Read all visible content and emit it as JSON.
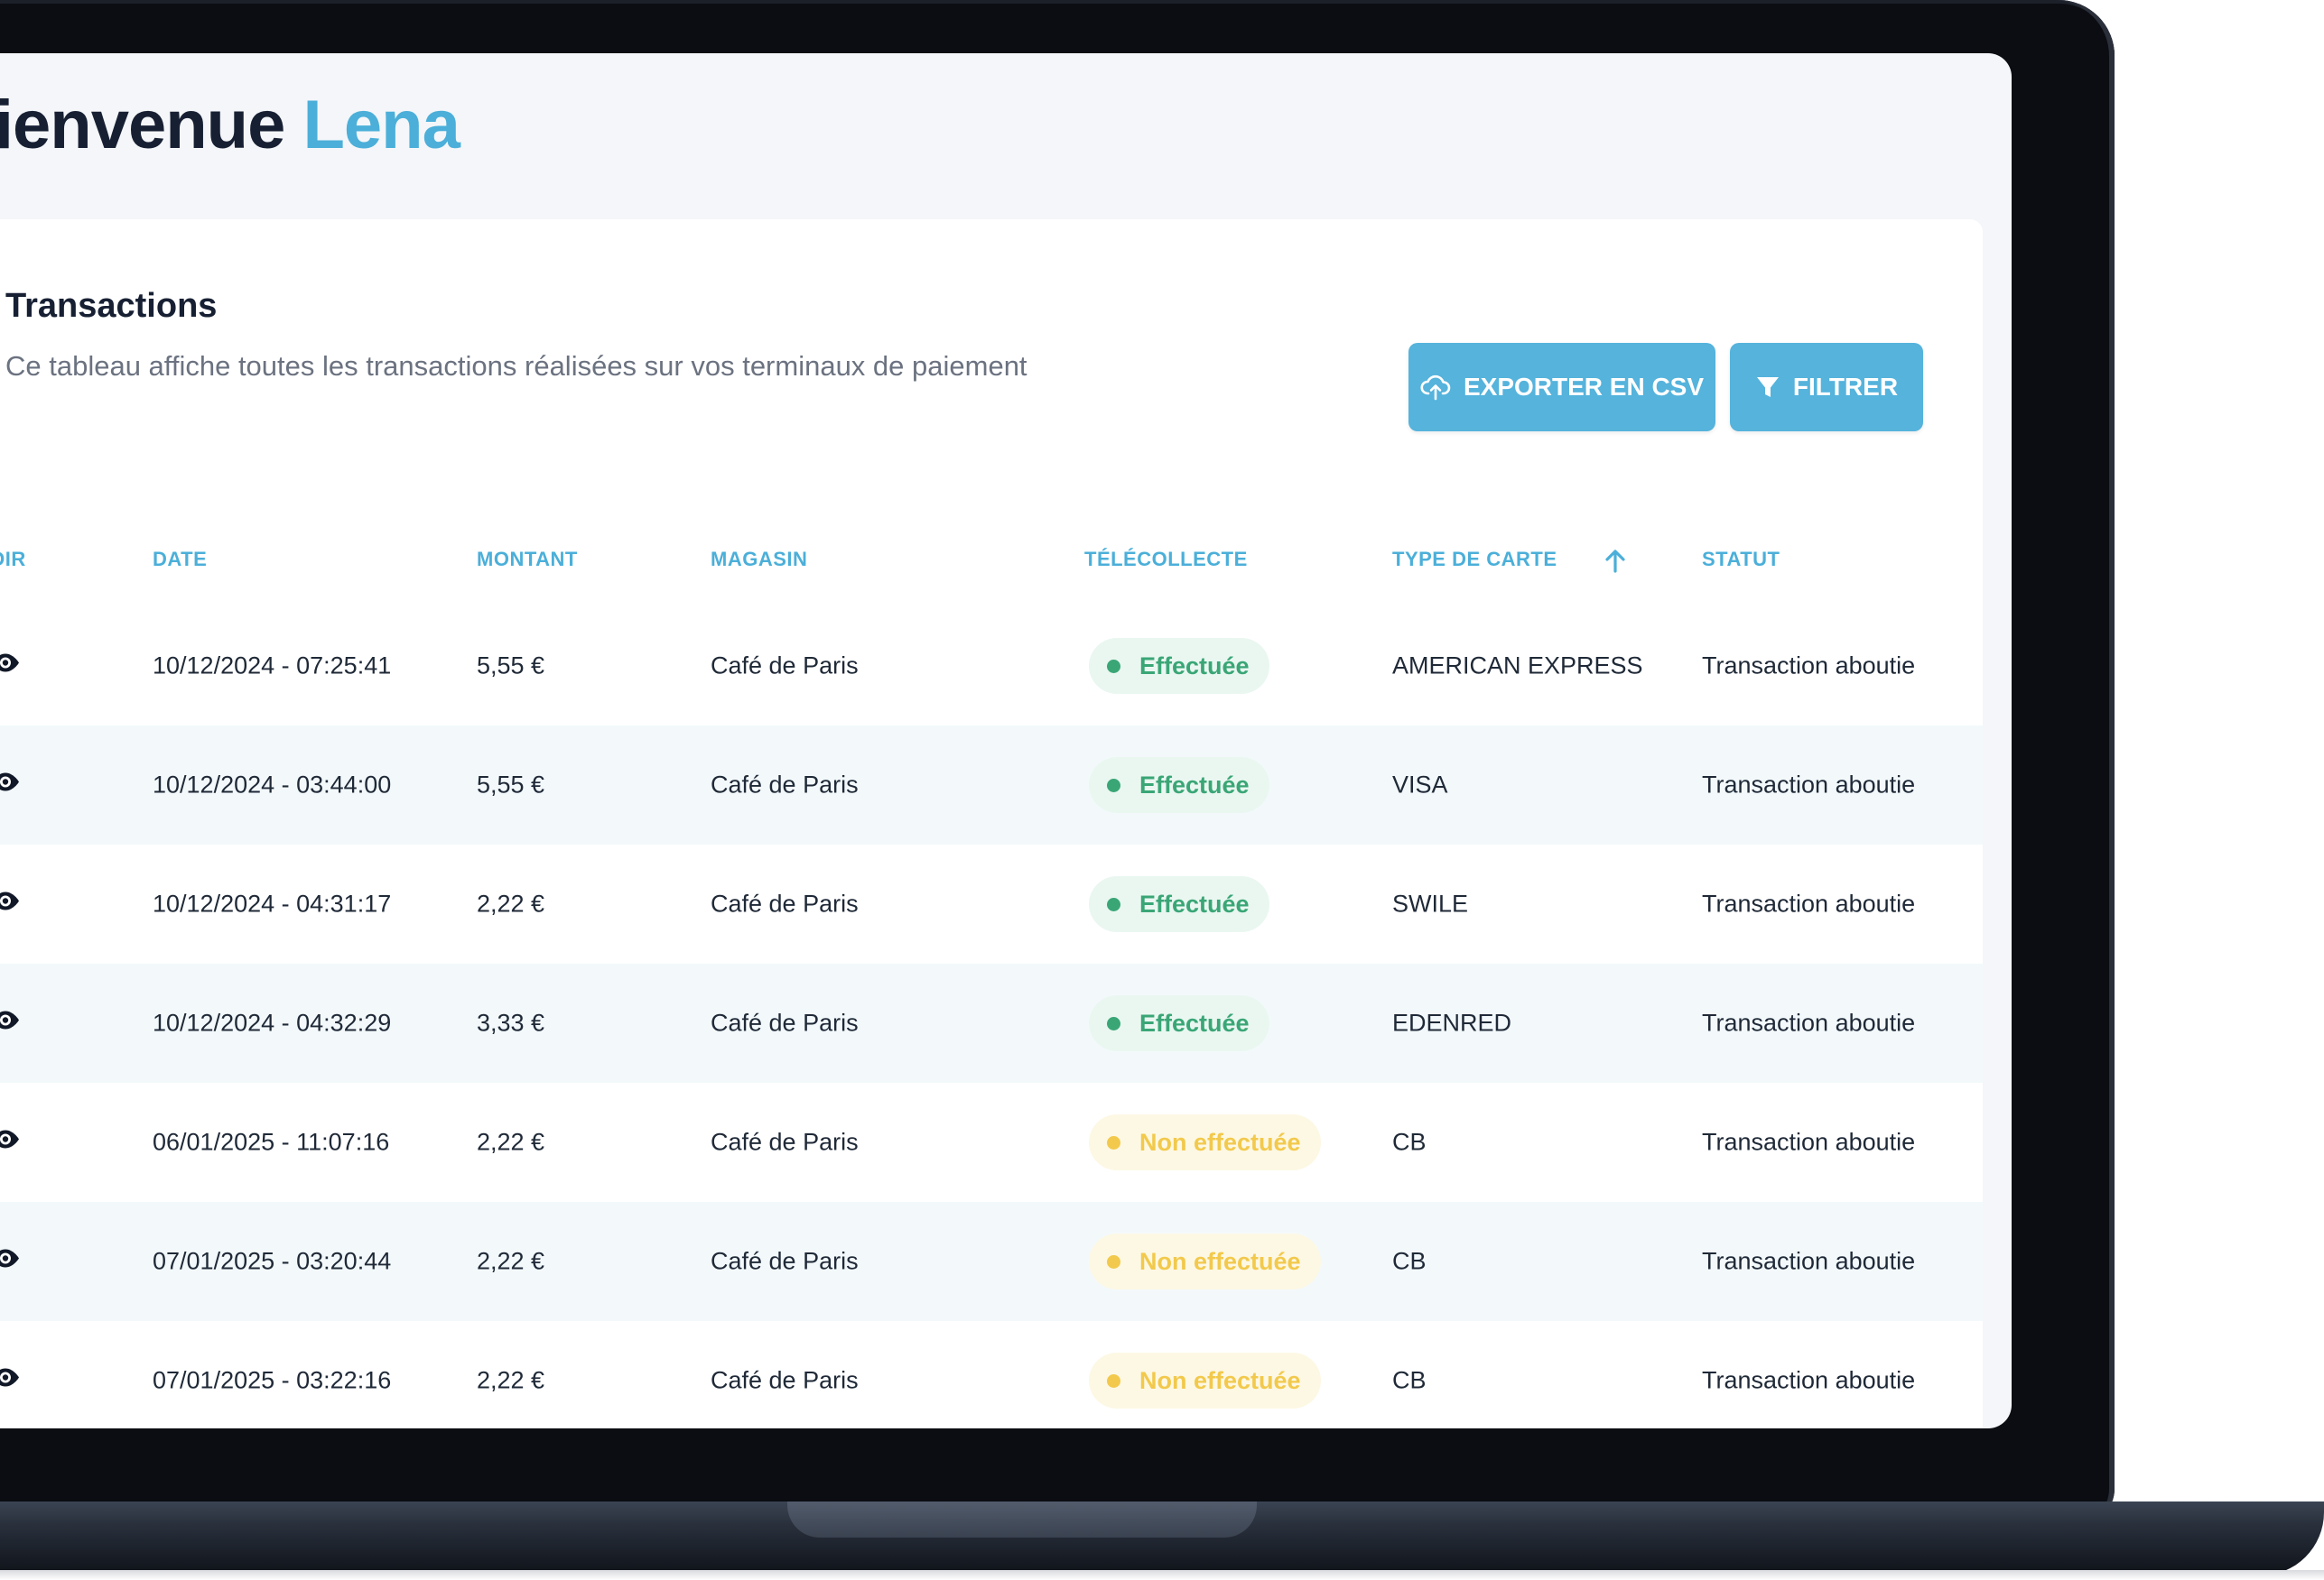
{
  "header": {
    "greeting": "Bienvenue",
    "user_name": "Lena"
  },
  "card": {
    "title": "Transactions",
    "subtitle": "Ce tableau affiche toutes les transactions réalisées sur vos terminaux de paiement",
    "export_label": "EXPORTER EN CSV",
    "filter_label": "FILTRER"
  },
  "table": {
    "columns": [
      "VOIR",
      "DATE",
      "MONTANT",
      "MAGASIN",
      "TÉLÉCOLLECTE",
      "TYPE DE CARTE",
      "STATUT"
    ],
    "sorted_column": "TYPE DE CARTE",
    "sort_direction": "asc",
    "rows": [
      {
        "date": "10/12/2024 - 07:25:41",
        "amount": "5,55 €",
        "store": "Café de Paris",
        "telecollecte": "Effectuée",
        "state": "ok",
        "card": "AMERICAN EXPRESS",
        "status": "Transaction aboutie"
      },
      {
        "date": "10/12/2024 - 03:44:00",
        "amount": "5,55 €",
        "store": "Café de Paris",
        "telecollecte": "Effectuée",
        "state": "ok",
        "card": "VISA",
        "status": "Transaction aboutie"
      },
      {
        "date": "10/12/2024 - 04:31:17",
        "amount": "2,22 €",
        "store": "Café de Paris",
        "telecollecte": "Effectuée",
        "state": "ok",
        "card": "SWILE",
        "status": "Transaction aboutie"
      },
      {
        "date": "10/12/2024 - 04:32:29",
        "amount": "3,33 €",
        "store": "Café de Paris",
        "telecollecte": "Effectuée",
        "state": "ok",
        "card": "EDENRED",
        "status": "Transaction aboutie"
      },
      {
        "date": "06/01/2025 - 11:07:16",
        "amount": "2,22 €",
        "store": "Café de Paris",
        "telecollecte": "Non effectuée",
        "state": "ko",
        "card": "CB",
        "status": "Transaction aboutie"
      },
      {
        "date": "07/01/2025 - 03:20:44",
        "amount": "2,22 €",
        "store": "Café de Paris",
        "telecollecte": "Non effectuée",
        "state": "ko",
        "card": "CB",
        "status": "Transaction aboutie"
      },
      {
        "date": "07/01/2025 - 03:22:16",
        "amount": "2,22 €",
        "store": "Café de Paris",
        "telecollecte": "Non effectuée",
        "state": "ko",
        "card": "CB",
        "status": "Transaction aboutie"
      }
    ]
  },
  "colors": {
    "accent": "#4bafd9",
    "button": "#55b3dc",
    "success": "#3aa676",
    "warning": "#f2c94c",
    "heading": "#172033"
  },
  "icons": {
    "row_view": "eye-icon",
    "export": "cloud-upload-icon",
    "filter": "filter-icon",
    "sort": "arrow-up-icon"
  }
}
